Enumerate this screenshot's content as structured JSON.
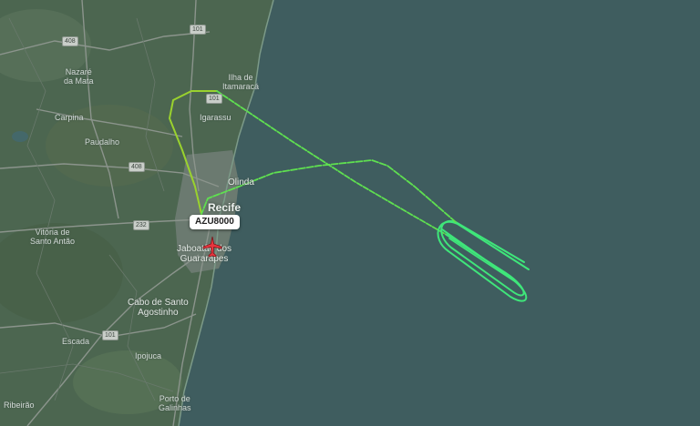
{
  "aircraft": {
    "callsign": "AZU8000",
    "icon": "airplane-icon",
    "color": "#e8363f"
  },
  "track": {
    "colors": [
      "#9ad22e",
      "#5fe050",
      "#3fe67a"
    ]
  },
  "places": {
    "nazare_da_mata": "Nazaré\nda Mata",
    "ilha_de_itamaraca": "Ilha de\nItamaracá",
    "carpina": "Carpina",
    "igarassu": "Igarassu",
    "paudalho": "Paudalho",
    "olinda": "Olinda",
    "recife": "Recife",
    "jaboatao": "Jaboatão dos\nGuararapes",
    "vitoria": "Vitória de\nSanto Antão",
    "cabo": "Cabo de Santo\nAgostinho",
    "escada": "Escada",
    "ipojuca": "Ipojuca",
    "porto_de_galinhas": "Porto de\nGalinhas",
    "ribeirao": "Ribeirão"
  },
  "road_shields": {
    "r408": "408",
    "r101_north": "101",
    "r101_mid": "101",
    "r408_mid": "408",
    "r232": "232",
    "r101_south": "101"
  }
}
